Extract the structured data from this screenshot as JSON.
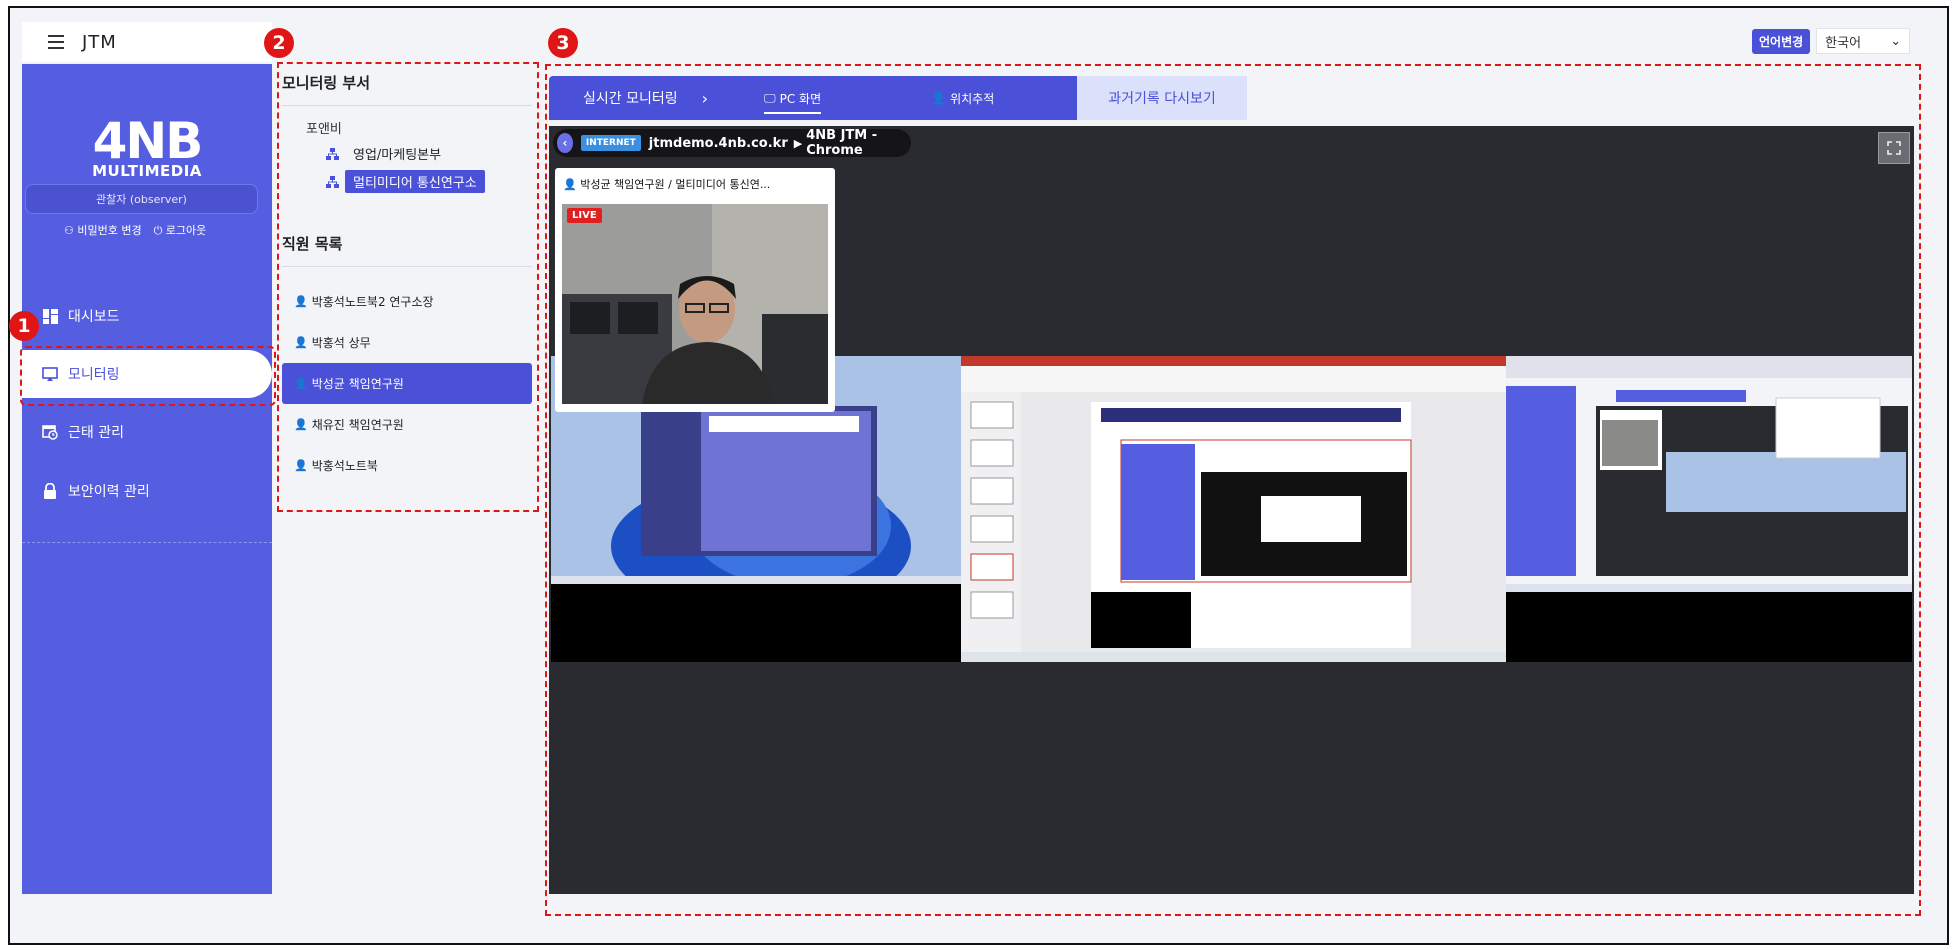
{
  "header": {
    "brand": "JTM"
  },
  "language": {
    "button": "언어변경",
    "selected": "한국어"
  },
  "sidebar": {
    "logo_big": "4NB",
    "logo_small": "MULTIMEDIA",
    "user_role": "관찰자 (observer)",
    "change_password": "비밀번호 변경",
    "logout": "로그아웃",
    "items": [
      {
        "label": "대시보드"
      },
      {
        "label": "모니터링"
      },
      {
        "label": "근태 관리"
      },
      {
        "label": "보안이력 관리"
      }
    ]
  },
  "departments": {
    "title": "모니터링 부서",
    "root": "포앤비",
    "nodes": [
      {
        "label": "영업/마케팅본부"
      },
      {
        "label": "멀티미디어 통신연구소"
      }
    ]
  },
  "employees": {
    "title": "직원 목록",
    "items": [
      {
        "label": "박홍석노트북2 연구소장"
      },
      {
        "label": "박홍석 상무"
      },
      {
        "label": "박성균 책임연구원"
      },
      {
        "label": "채유진 책임연구원"
      },
      {
        "label": "박홍석노트북"
      }
    ]
  },
  "tabs": {
    "live": "실시간 모니터링",
    "pc_screen": "PC 화면",
    "location": "위치추적",
    "past": "과거기록 다시보기"
  },
  "viewer": {
    "network": "INTERNET",
    "url": "jtmdemo.4nb.co.kr",
    "window": "4NB JTM - Chrome",
    "cam_title": "박성균 책임연구원 / 멀티미디어 통신연...",
    "live_badge": "LIVE"
  },
  "annotations": [
    "1",
    "2",
    "3"
  ],
  "colors": {
    "accent": "#4a50d8",
    "sidebar": "#555ee0",
    "annotation": "#e01515"
  },
  "icons": [
    "hamburger-icon",
    "user-key-icon",
    "power-icon",
    "dashboard-icon",
    "monitor-icon",
    "calendar-clock-icon",
    "lock-icon",
    "org-chart-icon",
    "user-icon",
    "chevron-right-icon",
    "fullscreen-icon",
    "chevron-left-icon",
    "chevron-down-icon"
  ]
}
